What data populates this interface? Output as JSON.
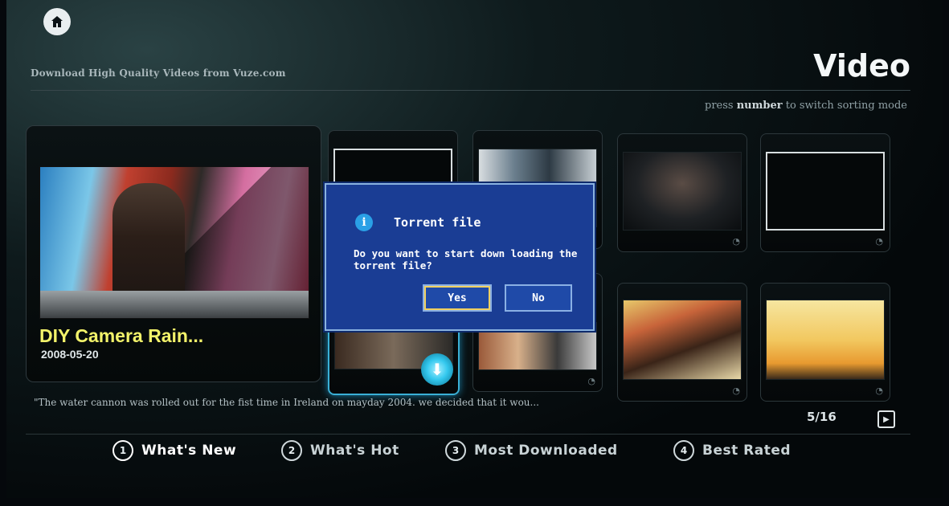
{
  "header": {
    "brand_text": "Download High Quality Videos from Vuze.com",
    "page_title": "Video",
    "sort_hint_prefix": "press",
    "sort_hint_key": "number",
    "sort_hint_suffix": "to switch sorting mode"
  },
  "featured": {
    "title": "DIY Camera Rain...",
    "date": "2008-05-20"
  },
  "dialog": {
    "title": "Torrent file",
    "message": "Do you want to start down loading the torrent file?",
    "yes_label": "Yes",
    "no_label": "No",
    "icon": "info-icon"
  },
  "description": "\"The water cannon was rolled out for the fist time in Ireland on mayday 2004. we decided that it wou...",
  "pager": {
    "text": "5/16"
  },
  "tabs": [
    {
      "num": "1",
      "label": "What's New"
    },
    {
      "num": "2",
      "label": "What's Hot"
    },
    {
      "num": "3",
      "label": "Most Downloaded"
    },
    {
      "num": "4",
      "label": "Best Rated"
    }
  ],
  "colors": {
    "featured_title": "#f2f26a",
    "dialog_bg": "#1a3d94",
    "selection_glow": "#3ab0d6"
  }
}
